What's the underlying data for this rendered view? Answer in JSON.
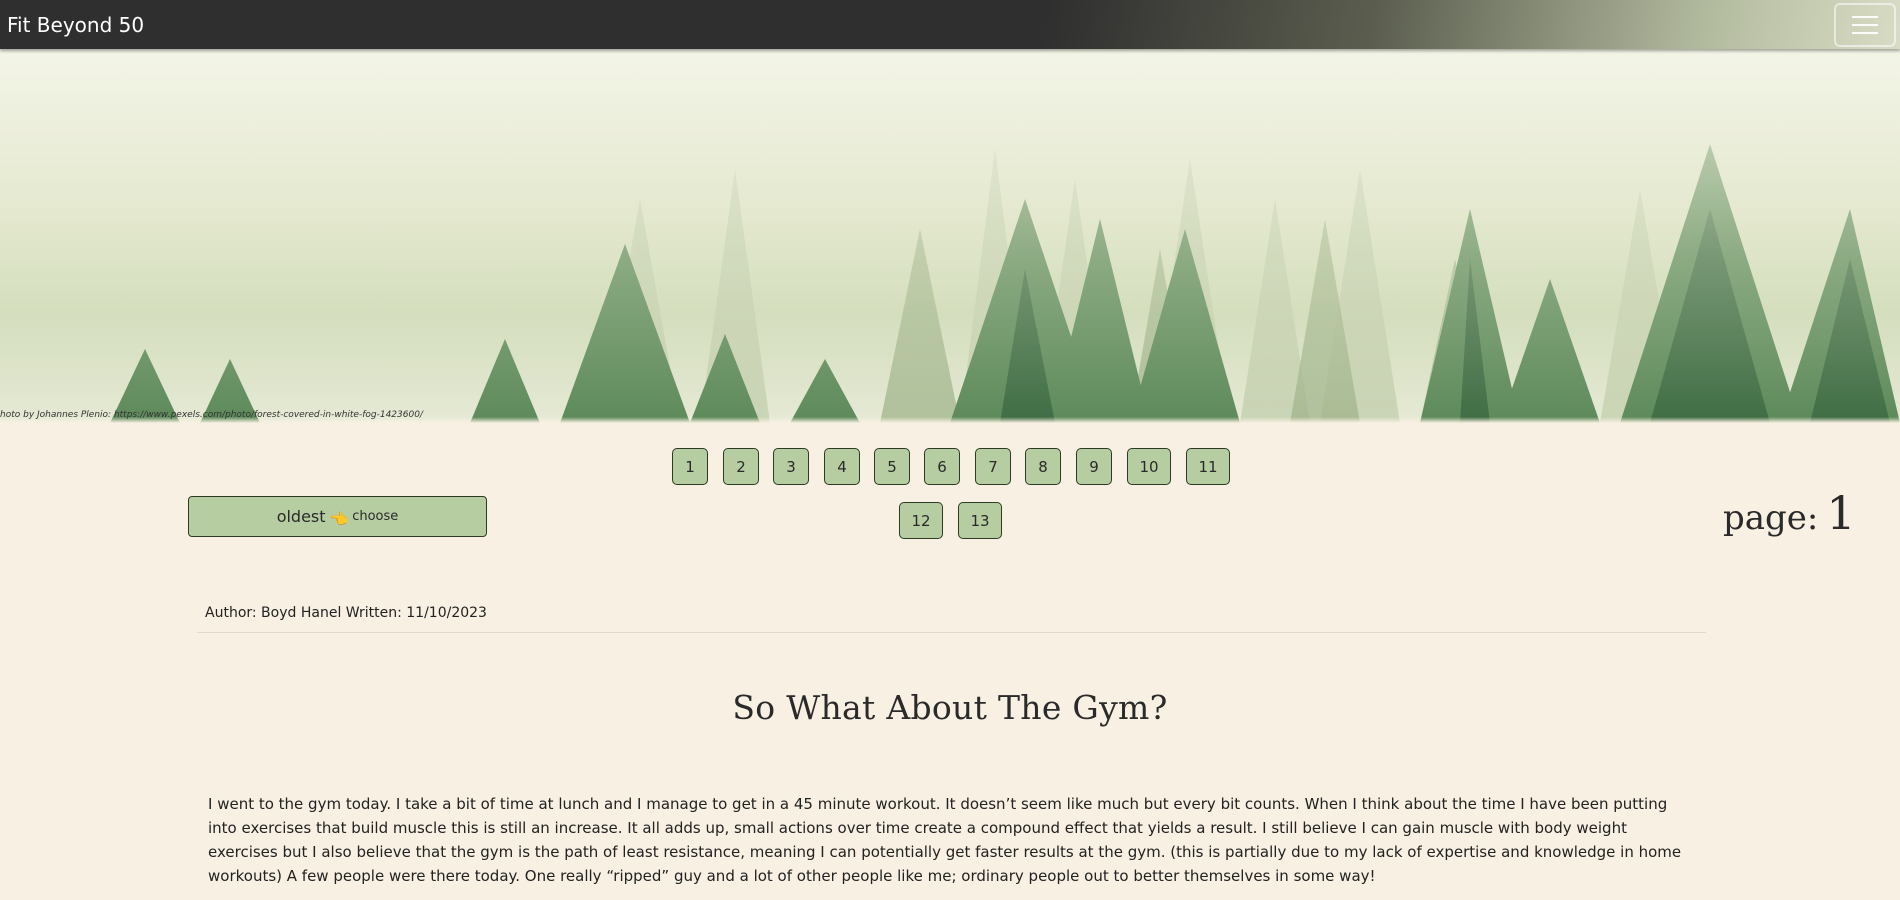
{
  "navbar": {
    "brand": "Fit Beyond 50",
    "menu_icon": "hamburger-menu-icon"
  },
  "hero": {
    "photo_credit": "hoto by Johannes Plenio: https://www.pexels.com/photo/forest-covered-in-white-fog-1423600/"
  },
  "pagination": {
    "row1": [
      "1",
      "2",
      "3",
      "4",
      "5",
      "6",
      "7",
      "8",
      "9",
      "10",
      "11"
    ],
    "row2": [
      "12",
      "13"
    ]
  },
  "sort": {
    "label": "oldest",
    "icon": "pointing-hand-icon",
    "hand_glyph": "👈",
    "action": "choose"
  },
  "page_indicator": {
    "label": "page:",
    "value": "1"
  },
  "article": {
    "meta": "Author: Boyd Hanel Written: 11/10/2023",
    "title": "So What About The Gym?",
    "body": "I went to the gym today. I take a bit of time at lunch and I manage to get in a 45 minute workout. It doesn’t seem like much but every bit counts. When I think about the time I have been putting into exercises that build muscle this is still an increase. It all adds up, small actions over time create a compound effect that yields a result. I still believe I can gain muscle with body weight exercises but I also believe that the gym is the path of least resistance, meaning I can potentially get faster results at the gym. (this is partially due to my lack of expertise and knowledge in home workouts) A few people were there today. One really “ripped” guy and a lot of other people like me; ordinary people out to better themselves in some way!"
  },
  "colors": {
    "page_background": "#f8f0e2",
    "button_green": "#b6cca1",
    "navbar_dark": "#2f2f2f"
  }
}
